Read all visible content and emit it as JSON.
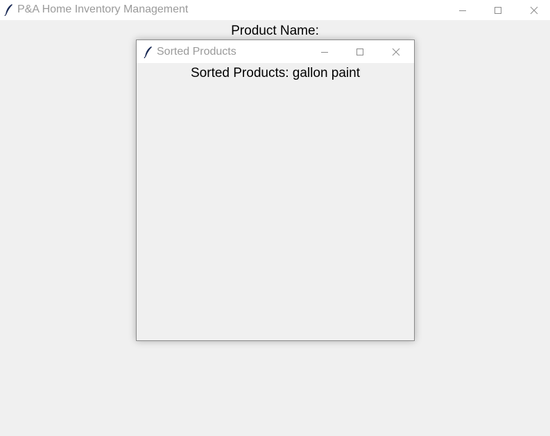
{
  "main_window": {
    "title": "P&A Home Inventory Management",
    "icon": "feather-icon",
    "product_name_label": "Product Name:",
    "controls": [
      "minimize-icon",
      "maximize-icon",
      "close-icon"
    ]
  },
  "dialog": {
    "title": "Sorted Products",
    "icon": "feather-icon",
    "content_label": "Sorted Products: gallon paint",
    "controls": [
      "minimize-icon",
      "maximize-icon",
      "close-icon"
    ]
  },
  "colors": {
    "background": "#f0f0f0",
    "titlebar": "#ffffff",
    "title_text": "#9a9a9a",
    "text": "#000000"
  }
}
